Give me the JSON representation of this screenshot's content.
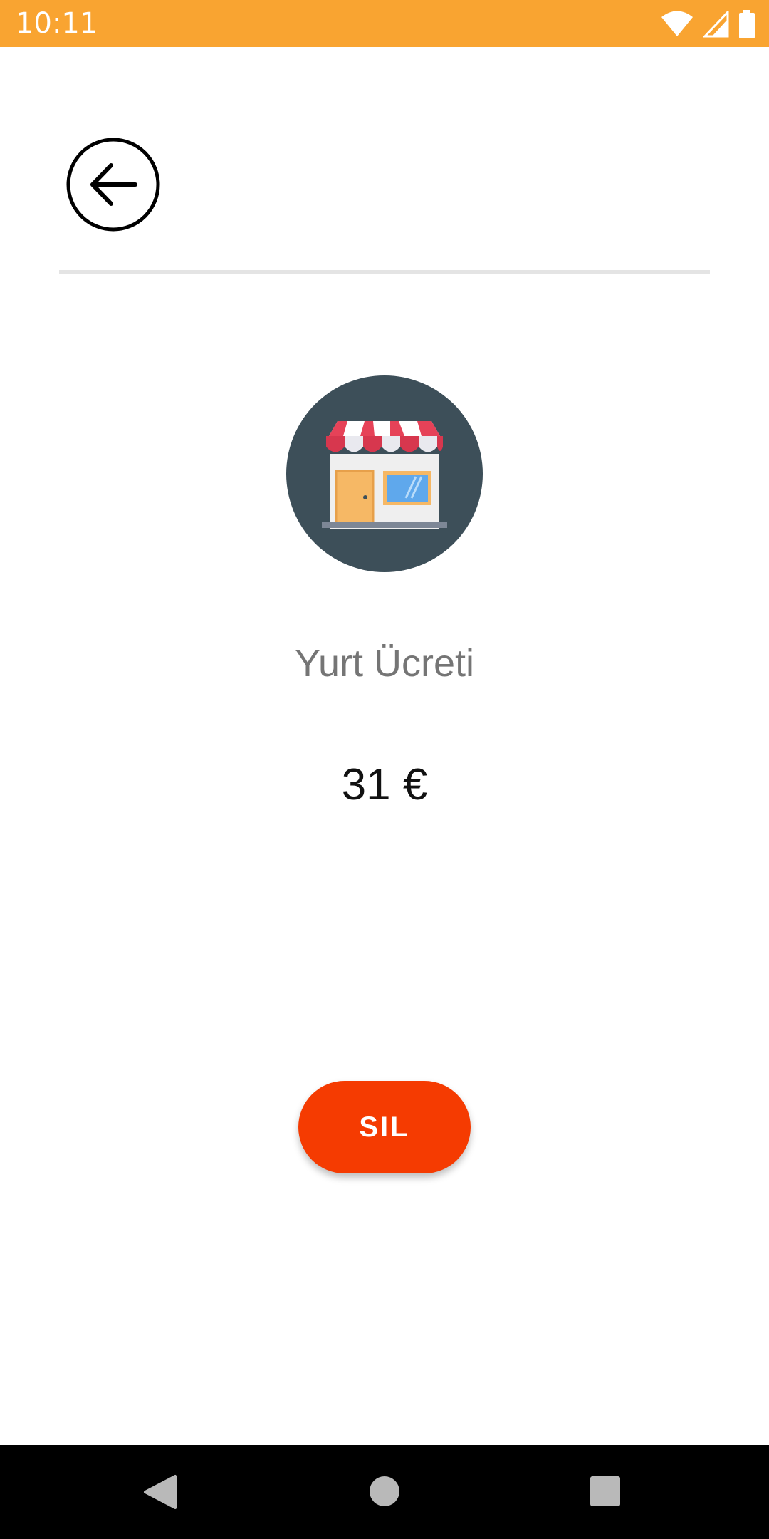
{
  "status_bar": {
    "time": "10:11",
    "background_color": "#F9A431",
    "icons": [
      "wifi-icon",
      "cell-signal-icon",
      "battery-icon"
    ]
  },
  "header": {
    "back_icon": "arrow-left-circle-icon"
  },
  "transaction": {
    "category_icon": "store-icon",
    "category_name": "Yurt Ücreti",
    "amount": "31 €"
  },
  "actions": {
    "delete_label": "SIL",
    "delete_color": "#F53B01"
  },
  "nav_bar": {
    "buttons": [
      "back-triangle-icon",
      "home-circle-icon",
      "recents-square-icon"
    ]
  }
}
